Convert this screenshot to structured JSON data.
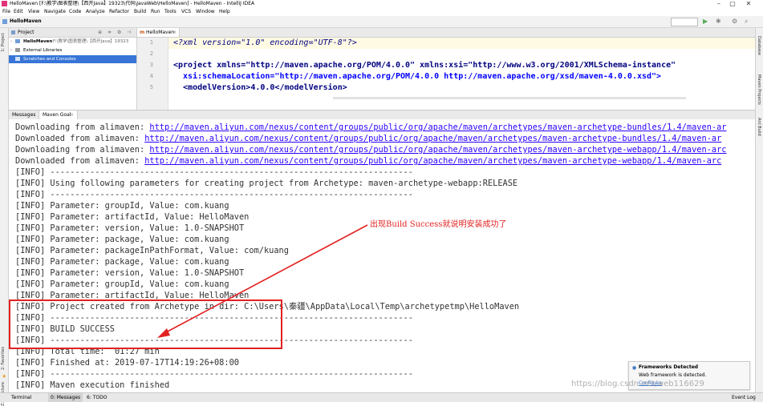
{
  "window": {
    "title": "HelloMaven [F:\\教学\\图表整理\\【西开Java】19323\\代码\\JavaWeb\\HelloMaven] - HelloMaven - IntelliJ IDEA",
    "controls": {
      "minimize": "–",
      "maximize": "▢",
      "close": "✕"
    }
  },
  "menu": [
    "File",
    "Edit",
    "View",
    "Navigate",
    "Code",
    "Analyze",
    "Refactor",
    "Build",
    "Run",
    "Tools",
    "VCS",
    "Window",
    "Help"
  ],
  "toolbar": {
    "breadcrumb": "HelloMaven"
  },
  "left_tabs": {
    "project": "1: Project",
    "favorites": "2: Favorites",
    "structure": "Z: Structure"
  },
  "project_panel": {
    "title": "Project",
    "items": [
      {
        "label": "HelloMaven",
        "detail": "F:\\教学\\图表整理\\【西开Java】19323",
        "selected": false
      },
      {
        "label": "External Libraries",
        "selected": false
      },
      {
        "label": "Scratches and Consoles",
        "selected": true
      }
    ]
  },
  "editor": {
    "tab": "HelloMaven",
    "lines": [
      {
        "n": "1",
        "text": "<?xml version=\"1.0\" encoding=\"UTF-8\"?>"
      },
      {
        "n": "2",
        "text": ""
      },
      {
        "n": "3",
        "text": "<project xmlns=\"http://maven.apache.org/POM/4.0.0\" xmlns:xsi=\"http://www.w3.org/2001/XMLSchema-instance\""
      },
      {
        "n": "4",
        "text": "  xsi:schemaLocation=\"http://maven.apache.org/POM/4.0.0 http://maven.apache.org/xsd/maven-4.0.0.xsd\">"
      },
      {
        "n": "5",
        "text": "  <modelVersion>4.0.0</modelVersion>"
      }
    ]
  },
  "right_tabs": {
    "database": "Database",
    "maven": "Maven Projects",
    "ant": "Ant Build"
  },
  "messages": {
    "tabs": [
      "Messages",
      "Maven Goal"
    ],
    "lines": [
      {
        "prefix": "Downloading from alimaven: ",
        "link": "http://maven.aliyun.com/nexus/content/groups/public/org/apache/maven/archetypes/maven-archetype-bundles/1.4/maven-ar"
      },
      {
        "prefix": "Downloaded from alimaven: ",
        "link": "http://maven.aliyun.com/nexus/content/groups/public/org/apache/maven/archetypes/maven-archetype-bundles/1.4/maven-ar"
      },
      {
        "prefix": "Downloading from alimaven: ",
        "link": "http://maven.aliyun.com/nexus/content/groups/public/org/apache/maven/archetypes/maven-archetype-webapp/1.4/maven-arc"
      },
      {
        "prefix": "Downloaded from alimaven: ",
        "link": "http://maven.aliyun.com/nexus/content/groups/public/org/apache/maven/archetypes/maven-archetype-webapp/1.4/maven-arc"
      },
      {
        "prefix": "[INFO] -------------------------------------------------------------------------",
        "link": ""
      },
      {
        "prefix": "[INFO] Using following parameters for creating project from Archetype: maven-archetype-webapp:RELEASE",
        "link": ""
      },
      {
        "prefix": "[INFO] -------------------------------------------------------------------------",
        "link": ""
      },
      {
        "prefix": "[INFO] Parameter: groupId, Value: com.kuang",
        "link": ""
      },
      {
        "prefix": "[INFO] Parameter: artifactId, Value: HelloMaven",
        "link": ""
      },
      {
        "prefix": "[INFO] Parameter: version, Value: 1.0-SNAPSHOT",
        "link": ""
      },
      {
        "prefix": "[INFO] Parameter: package, Value: com.kuang",
        "link": ""
      },
      {
        "prefix": "[INFO] Parameter: packageInPathFormat, Value: com/kuang",
        "link": ""
      },
      {
        "prefix": "[INFO] Parameter: package, Value: com.kuang",
        "link": ""
      },
      {
        "prefix": "[INFO] Parameter: version, Value: 1.0-SNAPSHOT",
        "link": ""
      },
      {
        "prefix": "[INFO] Parameter: groupId, Value: com.kuang",
        "link": ""
      },
      {
        "prefix": "[INFO] Parameter: artifactId, Value: HelloMaven",
        "link": ""
      },
      {
        "prefix": "[INFO] Project created from Archetype in dir: C:\\Users\\秦疆\\AppData\\Local\\Temp\\archetypetmp\\HelloMaven",
        "link": ""
      },
      {
        "prefix": "[INFO] -------------------------------------------------------------------------",
        "link": ""
      },
      {
        "prefix": "[INFO] BUILD SUCCESS",
        "link": ""
      },
      {
        "prefix": "[INFO] -------------------------------------------------------------------------",
        "link": ""
      },
      {
        "prefix": "[INFO] Total time:  01:27 min",
        "link": ""
      },
      {
        "prefix": "[INFO] Finished at: 2019-07-17T14:19:26+08:00",
        "link": ""
      },
      {
        "prefix": "[INFO] -------------------------------------------------------------------------",
        "link": ""
      },
      {
        "prefix": "[INFO] Maven execution finished",
        "link": ""
      }
    ]
  },
  "notification": {
    "title": "Frameworks Detected",
    "body": "Web framework is detected.",
    "action": "Configure"
  },
  "annotation": {
    "text": "出现Build Success就说明安装成功了",
    "color": "#e32222"
  },
  "bottom_tabs": {
    "terminal": "Terminal",
    "messages": "0: Messages",
    "todo": "6: TODO",
    "event_log": "Event Log"
  },
  "watermark": "https://blog.csdn.net/web116629"
}
